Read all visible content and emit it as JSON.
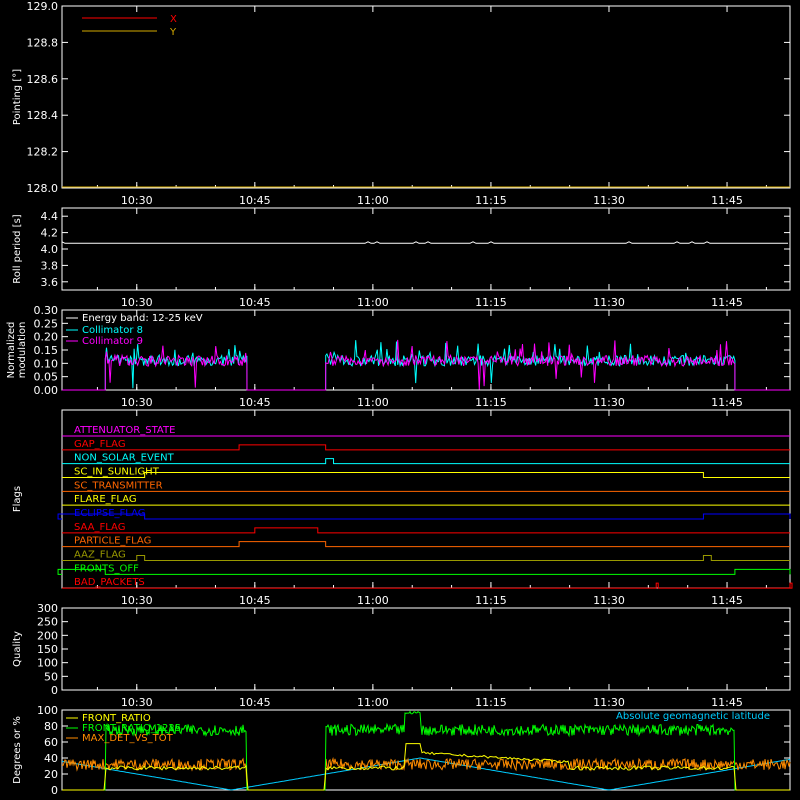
{
  "colors": {
    "background": "#000000",
    "axes": "#ffffff",
    "x": "#ff0000",
    "y": "#d4aa00",
    "collimator8": "#00ffff",
    "collimator9": "#ff00ff",
    "front_ratio": "#ffff00",
    "front_ratio_1225": "#00ff00",
    "max_det": "#ff8c00",
    "geomag": "#00ccff"
  },
  "chart_data": [
    {
      "type": "line",
      "ylabel": "Pointing [°]",
      "ylim": [
        128.0,
        129.0
      ],
      "yticks": [
        "128.0",
        "128.2",
        "128.4",
        "128.6",
        "128.8",
        "129.0"
      ],
      "xlim": [
        "10:20",
        "11:53"
      ],
      "xticks": [
        "10:30",
        "10:45",
        "11:00",
        "11:15",
        "11:30",
        "11:45"
      ],
      "series": [
        {
          "name": "X",
          "color": "#ff0000"
        },
        {
          "name": "Y",
          "color": "#d4aa00"
        }
      ],
      "grid": false,
      "legend": "top-left"
    },
    {
      "type": "line",
      "ylabel": "Roll period [s]",
      "ylim": [
        3.5,
        4.5
      ],
      "yticks": [
        "3.6",
        "3.8",
        "4.0",
        "4.2",
        "4.4"
      ],
      "xticks": [
        "10:30",
        "10:45",
        "11:00",
        "11:15",
        "11:30",
        "11:45"
      ],
      "series": [
        {
          "values_summary": "approximately constant at 4.07 s",
          "value": 4.07
        }
      ]
    },
    {
      "type": "line",
      "ylabel": "Normalized modulation",
      "ylim": [
        0,
        0.3
      ],
      "yticks": [
        "0.00",
        "0.05",
        "0.10",
        "0.15",
        "0.20",
        "0.25",
        "0.30"
      ],
      "xticks": [
        "10:30",
        "10:45",
        "11:00",
        "11:15",
        "11:30",
        "11:45"
      ],
      "annotations": [
        "Energy band: 12-25 keV"
      ],
      "series": [
        {
          "name": "Collimator 8",
          "color": "#00ffff",
          "segments": [
            [
              "10:26",
              "10:44"
            ],
            [
              "10:54",
              "11:46"
            ]
          ],
          "baseline": 0.09
        },
        {
          "name": "Collimator 9",
          "color": "#ff00ff",
          "segments": [
            [
              "10:26",
              "10:44"
            ],
            [
              "10:54",
              "11:46"
            ]
          ],
          "baseline": 0.09
        }
      ],
      "legend": "top-left"
    },
    {
      "type": "line",
      "ylabel": "Flags",
      "xticks": [
        "10:30",
        "10:45",
        "11:00",
        "11:15",
        "11:30",
        "11:45"
      ],
      "flags": [
        {
          "name": "ATTENUATOR_STATE",
          "color": "#ff00ff",
          "on": []
        },
        {
          "name": "GAP_FLAG",
          "color": "#ff0000",
          "on": [
            [
              "10:43",
              "10:54"
            ]
          ]
        },
        {
          "name": "NON_SOLAR_EVENT",
          "color": "#00ffff",
          "on": [
            [
              "10:54",
              "10:55"
            ]
          ]
        },
        {
          "name": "SC_IN_SUNLIGHT",
          "color": "#ffff00",
          "on": [
            [
              "10:31",
              "11:42"
            ]
          ]
        },
        {
          "name": "SC_TRANSMITTER",
          "color": "#ff6600",
          "on": []
        },
        {
          "name": "FLARE_FLAG",
          "color": "#ffff00",
          "on": []
        },
        {
          "name": "ECLIPSE_FLAG",
          "color": "#0000ff",
          "on": [
            [
              "10:20",
              "10:31"
            ],
            [
              "11:42",
              "11:53"
            ]
          ]
        },
        {
          "name": "SAA_FLAG",
          "color": "#ff0000",
          "on": [
            [
              "10:45",
              "10:53"
            ]
          ]
        },
        {
          "name": "PARTICLE_FLAG",
          "color": "#ff6600",
          "on": [
            [
              "10:43",
              "10:54"
            ]
          ]
        },
        {
          "name": "AAZ_FLAG",
          "color": "#999900",
          "on": [
            [
              "10:30",
              "10:31"
            ],
            [
              "11:42",
              "11:43"
            ]
          ]
        },
        {
          "name": "FRONTS_OFF",
          "color": "#00ff00",
          "on": [
            [
              "10:20",
              "10:26"
            ],
            [
              "11:46",
              "11:53"
            ]
          ]
        },
        {
          "name": "BAD_PACKETS",
          "color": "#ff0000",
          "on": [
            [
              "11:36",
              "11:36"
            ],
            [
              "11:53",
              "11:53"
            ]
          ]
        }
      ]
    },
    {
      "type": "line",
      "ylabel": "Quality",
      "ylim": [
        0,
        300
      ],
      "yticks": [
        "0",
        "50",
        "100",
        "150",
        "200",
        "250",
        "300"
      ],
      "xticks": [
        "10:30",
        "10:45",
        "11:00",
        "11:15",
        "11:30",
        "11:45"
      ]
    },
    {
      "type": "line",
      "ylabel": "Degrees or %",
      "ylim": [
        0,
        100
      ],
      "yticks": [
        "0",
        "20",
        "40",
        "60",
        "80",
        "100"
      ],
      "series": [
        {
          "name": "FRONT_RATIO",
          "color": "#ffff00"
        },
        {
          "name": "FRONT_RATIO_1225",
          "color": "#00ff00",
          "level": 75
        },
        {
          "name": "MAX_DET_VS_TOT",
          "color": "#ff8c00",
          "level": 27
        },
        {
          "name": "Absolute geomagnetic latitude",
          "color": "#00ccff",
          "range": [
            0,
            40
          ]
        }
      ],
      "legend": "top-left"
    }
  ]
}
